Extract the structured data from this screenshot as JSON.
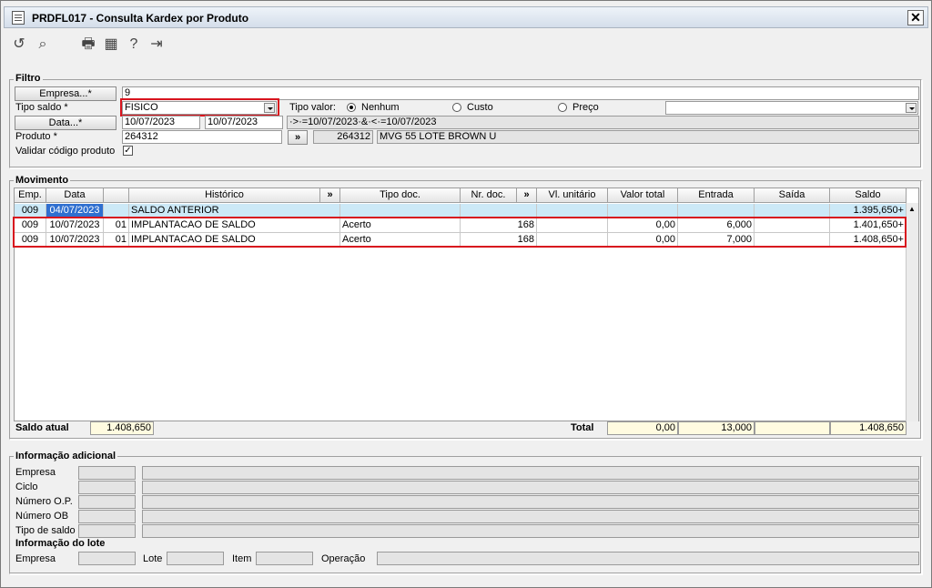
{
  "window": {
    "title": "PRDFL017 - Consulta Kardex por Produto",
    "close_label": "✕"
  },
  "toolbar": [
    {
      "name": "undo-icon",
      "glyph": "↺"
    },
    {
      "name": "search-icon",
      "glyph": "⌕"
    },
    {
      "name": "print-icon",
      "glyph": "🖶"
    },
    {
      "name": "calendar-icon",
      "glyph": "▦"
    },
    {
      "name": "help-icon",
      "glyph": "?"
    },
    {
      "name": "exit-icon",
      "glyph": "⇥"
    }
  ],
  "filtro": {
    "title": "Filtro",
    "empresa_button": "Empresa...*",
    "empresa_value": "9",
    "tipo_saldo_label": "Tipo saldo *",
    "tipo_saldo_value": "FISICO",
    "tipo_valor_label": "Tipo valor:",
    "tipo_valor_options": [
      "Nenhum",
      "Custo",
      "Preço"
    ],
    "tipo_valor_selected": "Nenhum",
    "data_button": "Data...*",
    "data_from": "10/07/2023",
    "data_to": "10/07/2023",
    "data_expr": "·>·=10/07/2023·&·<·=10/07/2023",
    "produto_label": "Produto *",
    "produto_value": "264312",
    "produto_button": "»",
    "produto_code": "264312",
    "produto_desc": "MVG 55 LOTE BROWN U",
    "validar_label": "Validar código produto",
    "validar_checked": true
  },
  "movimento": {
    "title": "Movimento",
    "columns": [
      "Emp.",
      "Data",
      "",
      "Histórico",
      "»",
      "Tipo doc.",
      "Nr. doc.",
      "»",
      "Vl. unitário",
      "Valor total",
      "Entrada",
      "Saída",
      "Saldo"
    ],
    "rows": [
      {
        "emp": "009",
        "data": "04/07/2023",
        "seq": "",
        "historico": "SALDO ANTERIOR",
        "tipo_doc": "",
        "nr_doc": "",
        "vl_unit": "",
        "valor_total": "",
        "entrada": "",
        "saida": "",
        "saldo": "1.395,650+"
      },
      {
        "emp": "009",
        "data": "10/07/2023",
        "seq": "01",
        "historico": "IMPLANTACAO DE SALDO",
        "tipo_doc": "Acerto",
        "nr_doc": "168",
        "vl_unit": "",
        "valor_total": "0,00",
        "entrada": "6,000",
        "saida": "",
        "saldo": "1.401,650+"
      },
      {
        "emp": "009",
        "data": "10/07/2023",
        "seq": "01",
        "historico": "IMPLANTACAO DE SALDO",
        "tipo_doc": "Acerto",
        "nr_doc": "168",
        "vl_unit": "",
        "valor_total": "0,00",
        "entrada": "7,000",
        "saida": "",
        "saldo": "1.408,650+"
      }
    ],
    "saldo_atual_label": "Saldo atual",
    "saldo_atual_value": "1.408,650",
    "total_label": "Total",
    "total_valor": "0,00",
    "total_entrada": "13,000",
    "total_saida": "",
    "total_saldo": "1.408,650"
  },
  "info_adicional": {
    "title": "Informação adicional",
    "labels": [
      "Empresa",
      "Ciclo",
      "Número O.P.",
      "Número OB",
      "Tipo de saldo"
    ]
  },
  "info_lote": {
    "title": "Informação do lote",
    "empresa": "Empresa",
    "lote": "Lote",
    "item": "Item",
    "operacao": "Operação"
  }
}
